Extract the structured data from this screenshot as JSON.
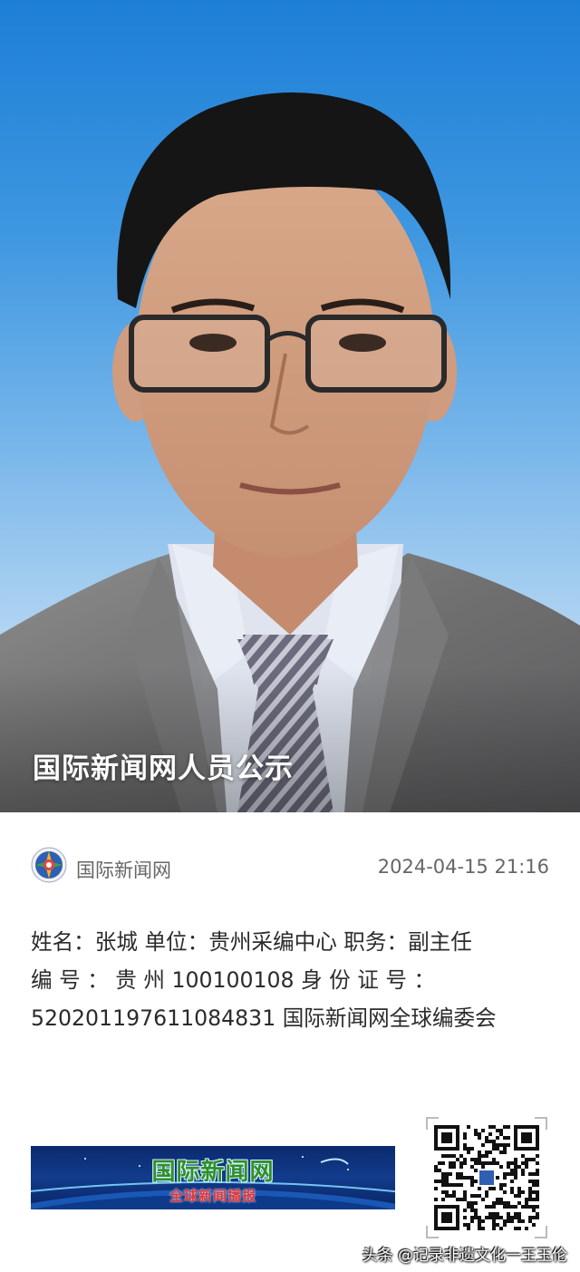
{
  "hero": {
    "caption": "国际新闻网人员公示"
  },
  "source": {
    "name": "国际新闻网",
    "time": "2024-04-15 21:16",
    "logo_icon": "globe-logo-icon"
  },
  "profile": {
    "line1": "姓名：张城 单位：贵州采编中心 职务：副主任",
    "line2_parts": [
      "编",
      "号",
      "：",
      "贵",
      "州",
      "100100108",
      "身",
      "份",
      "证",
      "号",
      "："
    ],
    "line3": "520201197611084831 国际新闻网全球编委会"
  },
  "banner": {
    "title": "国际新闻网",
    "subtitle": "全球新闻播报"
  },
  "qr": {
    "icon": "qr-code-icon"
  },
  "footer": {
    "watermark": "头条 @记录非遗文化一王玉伦"
  },
  "colors": {
    "sky_top": "#1d7fd6",
    "sky_bottom": "#cfe3f3",
    "text": "#2b2b2b",
    "muted": "#666666",
    "banner_blue": "#0b2a6e"
  }
}
